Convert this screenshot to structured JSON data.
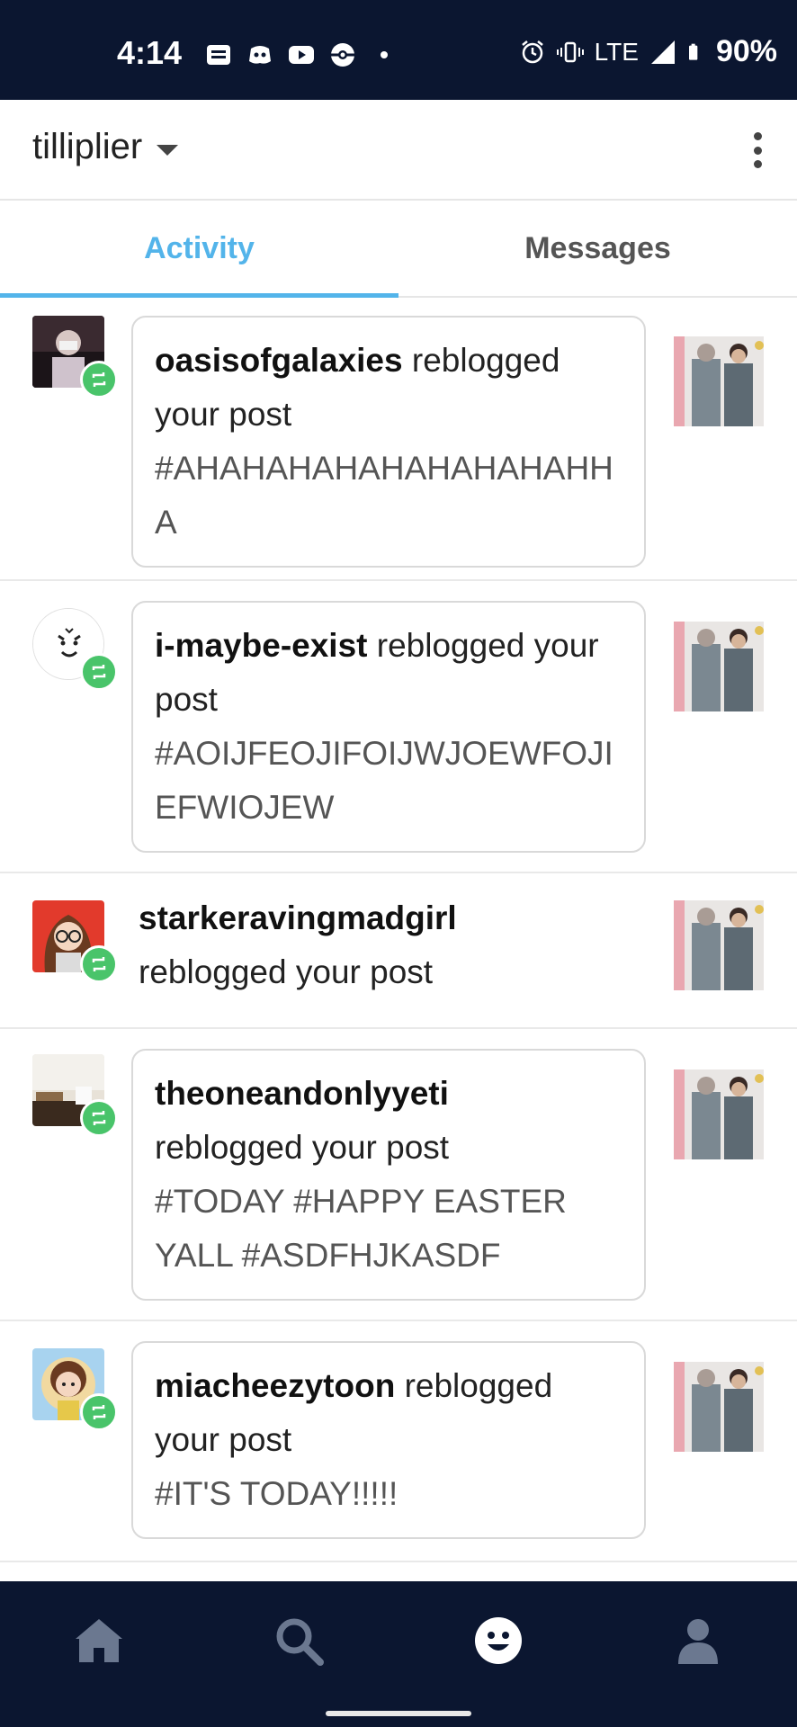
{
  "status_bar": {
    "time": "4:14",
    "network": "LTE",
    "battery": "90%"
  },
  "header": {
    "blog_name": "tilliplier"
  },
  "tabs": [
    {
      "label": "Activity",
      "active": true
    },
    {
      "label": "Messages",
      "active": false
    }
  ],
  "activity": [
    {
      "username": "oasisofgalaxies",
      "action": "reblogged your post",
      "tags": "#AHAHAHAHAHAHAHAHAHHA",
      "has_bubble": true
    },
    {
      "username": "i-maybe-exist",
      "action": "reblogged your post",
      "tags": "#AOIJFEOJIFOIJWJOEWFOJIEFWIOJEW",
      "has_bubble": true
    },
    {
      "username": "starkeravingmadgirl",
      "action": "reblogged your post",
      "tags": "",
      "has_bubble": false
    },
    {
      "username": "theoneandonlyyeti",
      "action": "reblogged your post",
      "tags": "#TODAY #HAPPY EASTER YALL #ASDFHJKASDF",
      "has_bubble": true
    },
    {
      "username": "miacheezytoon",
      "action": "reblogged your post",
      "tags": "#IT'S TODAY!!!!!",
      "has_bubble": true
    }
  ],
  "colors": {
    "status_bar_bg": "#0b1630",
    "active_tab": "#53b4ea",
    "reblog_badge": "#49c46a",
    "nav_active": "#ffffff",
    "nav_inactive": "#6b7890"
  },
  "bottom_nav": {
    "items": [
      "home-icon",
      "search-icon",
      "activity-face-icon",
      "account-icon"
    ],
    "active": "activity-face-icon"
  }
}
